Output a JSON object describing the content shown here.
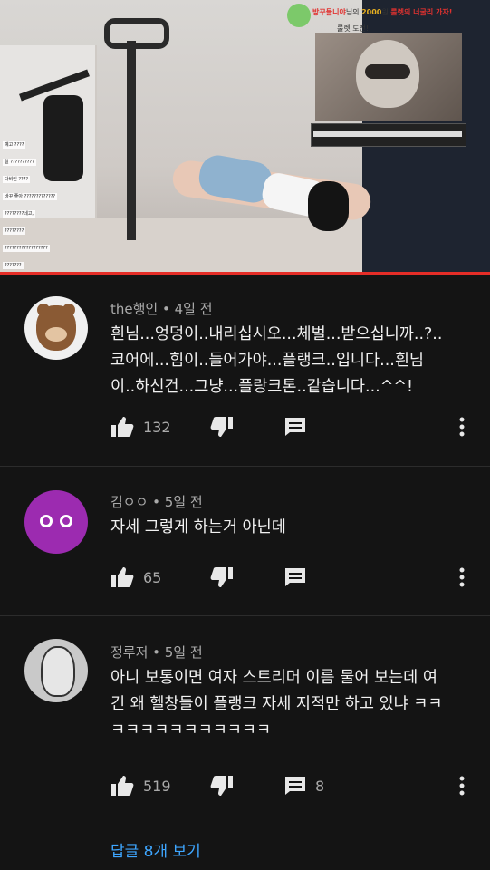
{
  "video": {
    "donation_text_prefix": "방꾸들니야",
    "donation_text_mid": "님의",
    "donation_amount": "2000",
    "donation_unit": "원",
    "donation_suffix_red": "룰렛의 너굴리 가자!",
    "donation_sub": "룰렛 도전!",
    "roulette_label": "꽝",
    "chat_lines": [
      "예고 ????",
      "일 ??????????",
      "다비인 ????",
      "바꾸 좋아 ?????????????",
      "????????네고,",
      "????????",
      "??????????????????",
      "???????",
      "??????????"
    ],
    "progress_fraction": 1.0,
    "accent_color": "#e52d27"
  },
  "comments": [
    {
      "author": "the행인",
      "age": "4일 전",
      "lines": [
        "흰님...엉덩이..내리십시오...체벌...받으십니까..?..",
        "코어에...힘이..들어가야...플랭크..입니다...흰님",
        "이..하신건...그냥...플랑크톤..같습니다...^^!"
      ],
      "likes": "132",
      "replies": "",
      "avatar_icon": "bear-avatar-icon"
    },
    {
      "author": "김ㅇㅇ",
      "age": "5일 전",
      "lines": [
        "자세 그렇게 하는거 아닌데"
      ],
      "likes": "65",
      "replies": "",
      "avatar_icon": "oo-avatar-icon"
    },
    {
      "author": "정루저",
      "age": "5일 전",
      "lines": [
        "아니 보통이면 여자 스트리머 이름 물어 보는데 여",
        "긴 왜 헬창들이 플랭크 자세 지적만 하고 있냐 ㅋㅋ",
        "ㅋㅋㅋㅋㅋㅋㅋㅋㅋㅋㅋ"
      ],
      "likes": "519",
      "replies": "8",
      "avatar_icon": "manga-avatar-icon"
    }
  ],
  "view_replies_label": "답글 8개 보기",
  "colors": {
    "background": "#141414",
    "secondary_text": "#aaaaaa",
    "link": "#3ea6ff"
  }
}
